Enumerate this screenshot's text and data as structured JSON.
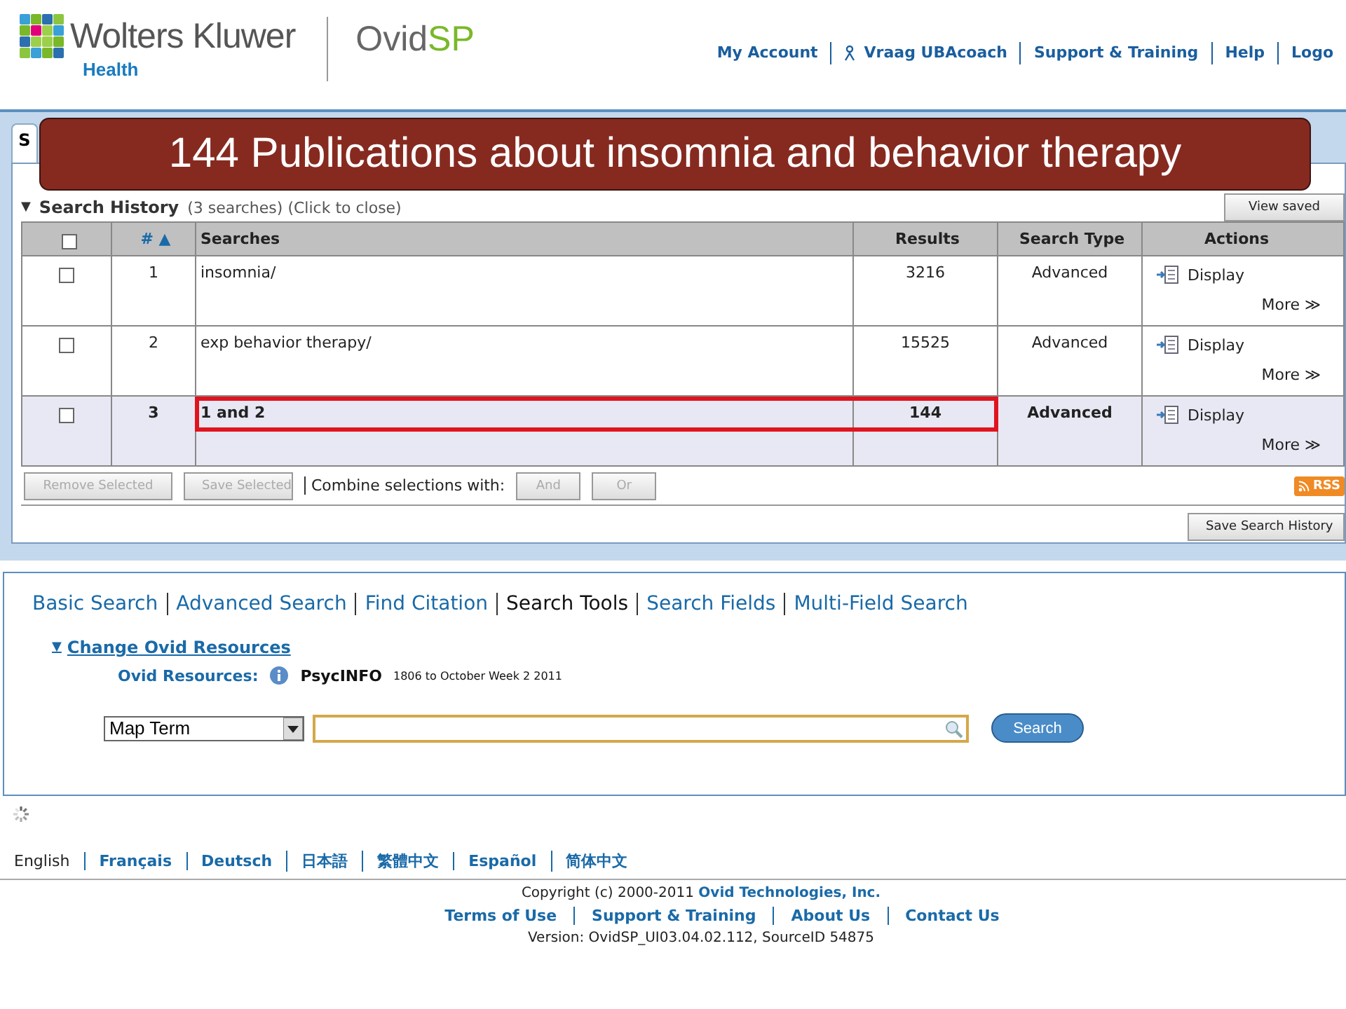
{
  "header": {
    "brand": "Wolters Kluwer",
    "division": "Health",
    "product": "Ovid",
    "product_accent": "SP",
    "nav": [
      {
        "label": "My Account",
        "kind": "link"
      },
      {
        "label": "Vraag UBAcoach",
        "kind": "help"
      },
      {
        "label": "Support & Training",
        "kind": "link"
      },
      {
        "label": "Help",
        "kind": "link"
      },
      {
        "label": "Logo",
        "kind": "link"
      }
    ]
  },
  "banner": {
    "text": "144 Publications about insomnia and behavior therapy"
  },
  "tabs": [
    {
      "label": "S",
      "selected": true
    }
  ],
  "history": {
    "toggle_icon": "▼",
    "title": "Search History",
    "subtitle": "(3 searches) (Click to close)",
    "view_saved": "View saved",
    "columns": [
      "# ▲",
      "Searches",
      "Results",
      "Search Type",
      "Actions"
    ],
    "rows": [
      {
        "number": "1",
        "search": "insomnia/",
        "results": "3216",
        "type": "Advanced",
        "action": "Display",
        "more": "More ≫",
        "checked": false,
        "selected": false,
        "highlighted": false
      },
      {
        "number": "2",
        "search": "exp behavior therapy/",
        "results": "15525",
        "type": "Advanced",
        "action": "Display",
        "more": "More ≫",
        "checked": false,
        "selected": false,
        "highlighted": false
      },
      {
        "number": "3",
        "search": "1 and 2",
        "results": "144",
        "type": "Advanced",
        "action": "Display",
        "more": "More ≫",
        "checked": false,
        "selected": true,
        "highlighted": true
      }
    ],
    "select_all_checked": false,
    "toolbar": [
      {
        "label": "Remove Selected",
        "disabled": true
      },
      {
        "label": "Save Selected",
        "disabled": true
      }
    ],
    "combine_label": "Combine selections with:",
    "combine_buttons": [
      {
        "label": "And",
        "disabled": true
      },
      {
        "label": "Or",
        "disabled": true
      }
    ],
    "rss": "RSS",
    "save_history": "Save Search History"
  },
  "search_tabs": [
    {
      "label": "Basic Search",
      "selected": false
    },
    {
      "label": "Advanced Search",
      "selected": false
    },
    {
      "label": "Find Citation",
      "selected": false
    },
    {
      "label": "Search Tools",
      "selected": true
    },
    {
      "label": "Search Fields",
      "selected": false
    },
    {
      "label": "Multi-Field Search",
      "selected": false
    }
  ],
  "resources": {
    "toggle_icon": "▼",
    "toggle": "Change Ovid Resources",
    "label": "Ovid Resources:",
    "database": "PsycINFO",
    "coverage": "1806 to October Week 2 2011"
  },
  "search": {
    "field_type": "Map Term",
    "button": "Search"
  },
  "languages": [
    {
      "label": "English",
      "selected": true
    },
    {
      "label": "Français",
      "selected": false
    },
    {
      "label": "Deutsch",
      "selected": false
    },
    {
      "label": "日本語",
      "selected": false
    },
    {
      "label": "繁體中文",
      "selected": false
    },
    {
      "label": "Español",
      "selected": false
    },
    {
      "label": "简体中文",
      "selected": false
    }
  ],
  "footer": {
    "copyright": "Copyright (c) 2000-2011",
    "company": "Ovid Technologies, Inc.",
    "links": [
      "Terms of Use",
      "Support & Training",
      "About Us",
      "Contact Us"
    ],
    "version": "Version: OvidSP_UI03.04.02.112, SourceID 54875"
  }
}
